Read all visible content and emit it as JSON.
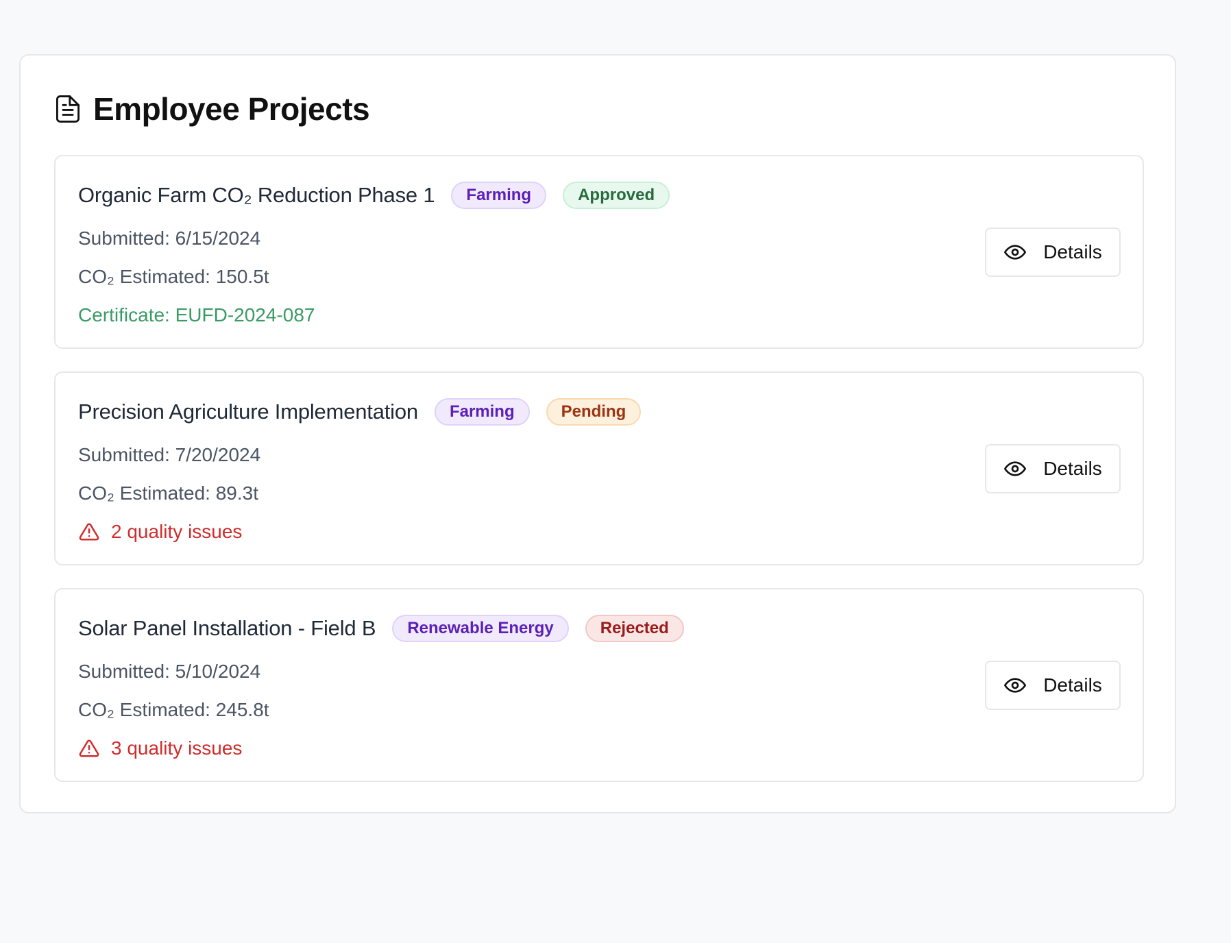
{
  "header": {
    "title": "Employee Projects",
    "icon": "document-icon"
  },
  "projects": [
    {
      "title": "Organic Farm CO₂ Reduction Phase 1",
      "category": "Farming",
      "status": "Approved",
      "submitted": "Submitted: 6/15/2024",
      "co2": "CO₂ Estimated: 150.5t",
      "extra": "Certificate: EUFD-2024-087",
      "extra_type": "certificate",
      "details_label": "Details"
    },
    {
      "title": "Precision Agriculture Implementation",
      "category": "Farming",
      "status": "Pending",
      "submitted": "Submitted: 7/20/2024",
      "co2": "CO₂ Estimated: 89.3t",
      "extra": "2 quality issues",
      "extra_type": "issues",
      "details_label": "Details"
    },
    {
      "title": "Solar Panel Installation - Field B",
      "category": "Renewable Energy",
      "status": "Rejected",
      "submitted": "Submitted: 5/10/2024",
      "co2": "CO₂ Estimated: 245.8t",
      "extra": "3 quality issues",
      "extra_type": "issues",
      "details_label": "Details"
    }
  ],
  "colors": {
    "page_background": "#f8f9fb",
    "category_badge": "#5b21b6",
    "approved": "#276b3d",
    "pending": "#9a3412",
    "rejected": "#991b1b",
    "certificate": "#3a9a65",
    "issues": "#d02c2c"
  },
  "icons": {
    "details": "eye-icon",
    "issues": "warning-triangle-icon"
  }
}
